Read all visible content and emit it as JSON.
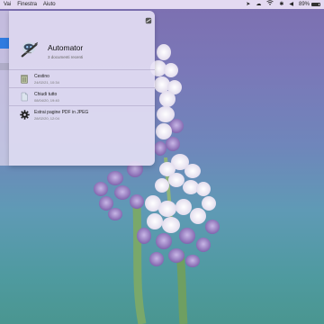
{
  "menubar": {
    "items": [
      "Vai",
      "Finestra",
      "Aiuto"
    ],
    "battery_percent": "89%",
    "status_icons": [
      "location-arrow-icon",
      "cloud-icon",
      "wifi-icon",
      "bluetooth-icon",
      "volume-icon",
      "battery-icon"
    ]
  },
  "stack": {
    "app_name": "Automator",
    "subtitle": "3 documenti recenti",
    "documents": [
      {
        "name": "Cestino",
        "date": "24/02/21, 10:34",
        "icon": "trash-workflow-icon"
      },
      {
        "name": "Chiudi tutto",
        "date": "08/04/20, 19:40",
        "icon": "blank-document-icon"
      },
      {
        "name": "Estrai pagine PDF in JPEG",
        "date": "28/02/20, 12:04",
        "icon": "gear-icon"
      }
    ]
  },
  "colors": {
    "selection": "#2f7be0",
    "popover_bg": "#e8e2f6"
  }
}
